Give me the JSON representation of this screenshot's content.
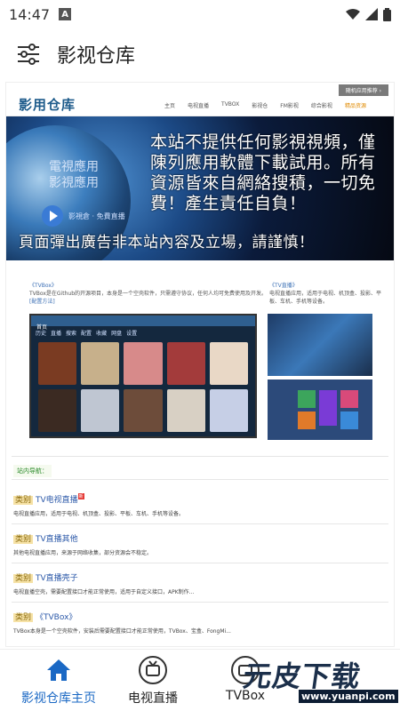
{
  "status_bar": {
    "time": "14:47",
    "notification_letter": "A"
  },
  "app_bar": {
    "title": "影视仓库",
    "menu_icon": "sliders-icon"
  },
  "webpage": {
    "logo": "影用仓库",
    "top_button": "随机应用推荐 ›",
    "nav": [
      "主页",
      "电视直播",
      "TVBOX",
      "影视仓",
      "FM影视",
      "综合影视",
      "精品资源"
    ],
    "banner": {
      "small_title_line1": "電視應用",
      "small_title_line2": "影視應用",
      "video_caption": "影視倉 · 免費直播",
      "disclaimer": "本站不提供任何影視視頻，僅陳列應用軟體下載試用。所有資源皆來自網絡搜積，一切免費！產生責任自負！",
      "bottom_notice": "頁面彈出廣告非本站內容及立場，請謹慎！"
    },
    "intro_left": {
      "tag": "《TVBox》",
      "text": "TVBox是在Github的开源项目，本身是一个空壳软件，只需遵守协议，任何人均可免费使用及开发。",
      "link": "[配置方法]"
    },
    "intro_right": {
      "tag": "《TV直播》",
      "text": "电视直播应用，适用于电视、机顶盒、投影、平板、车机、手机等设备。"
    },
    "tv_screenshot": {
      "header": "首页",
      "categories": [
        "历史",
        "直播",
        "搜索",
        "配置",
        "收藏",
        "网盘",
        "设置"
      ]
    },
    "quick_nav_label": "站内导航：",
    "categories": [
      {
        "label": "类别",
        "title": "TV电视直播",
        "badge": "新",
        "desc": "电视直播应用，适用于电视、机顶盒、投影、平板、车机、手机等设备。"
      },
      {
        "label": "类别",
        "title": "TV直播其他",
        "desc": "其他电视直播应用，来源于网络收集，部分资源会不稳定。"
      },
      {
        "label": "类别",
        "title": "TV直播壳子",
        "desc": "电视直播空壳，需要配置接口才能正常使用，适用于自定义接口，APK制作..."
      },
      {
        "label": "类别",
        "title": "《TVBox》",
        "desc": "TVBox本身是一个空壳软件，安装后需要配置接口才能正常使用，TVBox、宝盒、FongMi..."
      }
    ]
  },
  "bottom_nav": [
    {
      "label": "影视仓库主页",
      "icon": "home-icon",
      "active": true
    },
    {
      "label": "电视直播",
      "icon": "tv-icon",
      "active": false
    },
    {
      "label": "TVBox",
      "icon": "tv-icon",
      "active": false
    }
  ],
  "watermark": {
    "brand": "元皮下载",
    "url": "www.yuanpi.com"
  },
  "colors": {
    "accent": "#1a68c4",
    "link": "#2b58a8"
  }
}
